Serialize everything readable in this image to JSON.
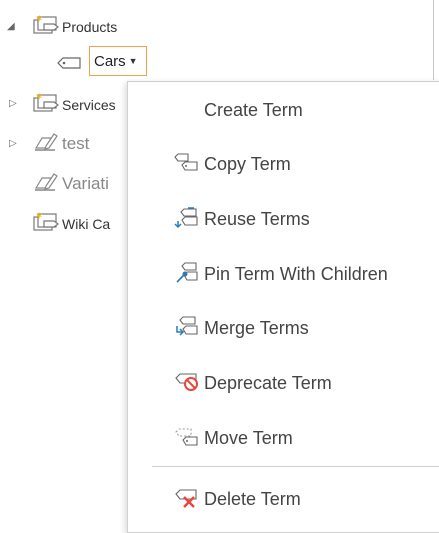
{
  "tree": {
    "nodes": [
      {
        "label": "Products",
        "icon": "term-set-icon",
        "expanded": true
      },
      {
        "label": "Cars",
        "icon": "term-tag-icon",
        "selected": true
      },
      {
        "label": "Services",
        "icon": "term-set-icon",
        "expanded": false
      },
      {
        "label": "test",
        "icon": "keyword-set-icon",
        "expanded": false
      },
      {
        "label": "Variati",
        "icon": "keyword-set-icon"
      },
      {
        "label": "Wiki Ca",
        "icon": "term-set-icon"
      }
    ]
  },
  "menu": {
    "items": [
      {
        "label": "Create Term",
        "icon": ""
      },
      {
        "label": "Copy Term",
        "icon": "copy-term-icon"
      },
      {
        "label": "Reuse Terms",
        "icon": "reuse-terms-icon"
      },
      {
        "label": "Pin Term With Children",
        "icon": "pin-term-icon"
      },
      {
        "label": "Merge Terms",
        "icon": "merge-terms-icon"
      },
      {
        "label": "Deprecate Term",
        "icon": "deprecate-term-icon"
      },
      {
        "label": "Move Term",
        "icon": "move-term-icon"
      },
      {
        "label": "Delete Term",
        "icon": "delete-term-icon"
      }
    ]
  },
  "colors": {
    "selected_border": "#f0a14a",
    "term_set_star": "#f4b400",
    "deprecate_red": "#e8463c",
    "arrow_blue": "#2a7ab8"
  }
}
